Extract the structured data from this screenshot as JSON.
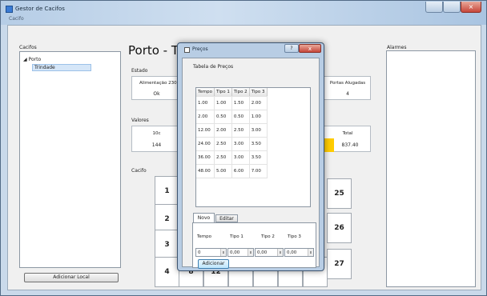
{
  "window": {
    "title": "Gestor de Cacifos",
    "menu": "Cacifo"
  },
  "tree": {
    "label": "Cacifos",
    "nodes": [
      "Porto",
      "Trindade"
    ]
  },
  "add_location_button": "Adicionar Local",
  "page_title": "Porto - Trin",
  "estado": {
    "label": "Estado",
    "power_header": "Alimentação 230",
    "power_value": "Ok",
    "rented_header": "Portas Alugadas",
    "rented_value": "4"
  },
  "valores": {
    "label": "Valores",
    "first_header": "10c",
    "first_value": "144",
    "total_header": "Total",
    "total_value": "837.40",
    "total_highlight_color": "#ffcc00"
  },
  "cacifo": {
    "label": "Cacifo",
    "left_column": [
      "1",
      "2",
      "3",
      "4"
    ],
    "bottom_visible": [
      "8",
      "12"
    ],
    "right_column": [
      "25",
      "26",
      "27"
    ]
  },
  "alarms": {
    "label": "Alarmes"
  },
  "dialog": {
    "title": "Preços",
    "help_symbol": "?",
    "close_symbol": "x",
    "table_label": "Tabela de Preços",
    "columns": [
      "Tempo",
      "Tipo 1",
      "Tipo 2",
      "Tipo 3"
    ],
    "rows": [
      [
        "1.00",
        "1.00",
        "1.50",
        "2.00"
      ],
      [
        "2.00",
        "0.50",
        "0.50",
        "1.00"
      ],
      [
        "12.00",
        "2.00",
        "2.50",
        "3.00"
      ],
      [
        "24.00",
        "2.50",
        "3.00",
        "3.50"
      ],
      [
        "36.00",
        "2.50",
        "3.00",
        "3.50"
      ],
      [
        "48.00",
        "5.00",
        "6.00",
        "7.00"
      ]
    ],
    "tabs": [
      "Novo",
      "Editar"
    ],
    "form": {
      "labels": [
        "Tempo",
        "Tipo 1",
        "Tipo 2",
        "Tipo 3"
      ],
      "values": [
        "0",
        "0,00",
        "0,00",
        "0,00"
      ]
    },
    "add_button": "Adicionar"
  }
}
